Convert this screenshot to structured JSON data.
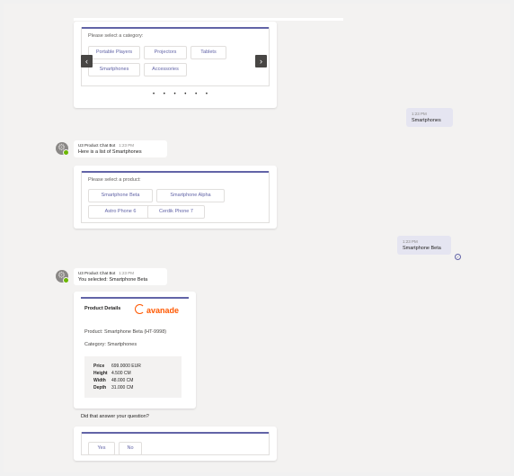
{
  "carousel": {
    "prompt": "Please select a category:",
    "chips": [
      "Portable Players",
      "Projectors",
      "Tablets",
      "Smartphones",
      "Accessories"
    ],
    "prev_icon": "chevron-left-icon",
    "next_icon": "chevron-right-icon",
    "dots": "• • • • • •"
  },
  "user_msg_1": {
    "time": "1:23 PM",
    "text": "Smartphones"
  },
  "bot_msg_1": {
    "sender": "U3 Product Chat Bot",
    "time": "1:23 PM",
    "text": "Here is a list of Smartphones"
  },
  "product_card": {
    "prompt": "Please select a product:",
    "chips": [
      "Smartphone Beta",
      "Smartphone Alpha",
      "Astro Phone 6",
      "Cerdik Phone 7"
    ]
  },
  "user_msg_2": {
    "time": "1:23 PM",
    "text": "Smartphone Beta"
  },
  "bot_msg_2": {
    "sender": "U3 Product Chat Bot",
    "time": "1:23 PM",
    "text": "You selected: Smartphone Beta"
  },
  "details_card": {
    "title": "Product Details",
    "logo_text": "avanade",
    "product": "Product: Smartphone Beta (HT-9998)",
    "category": "Category: Smartphones",
    "specs": [
      {
        "label": "Price",
        "value": "699.0000 EUR"
      },
      {
        "label": "Height",
        "value": "4.500 CM"
      },
      {
        "label": "Width",
        "value": "48.000 CM"
      },
      {
        "label": "Depth",
        "value": "31.000 CM"
      }
    ]
  },
  "question": "Did that answer your question?",
  "answer_chips": [
    "Yes",
    "No"
  ],
  "colors": {
    "accent": "#6264a7",
    "background": "#f3f2f1",
    "own_bubble": "#e5e5f1",
    "brand_orange": "#ff5800"
  }
}
